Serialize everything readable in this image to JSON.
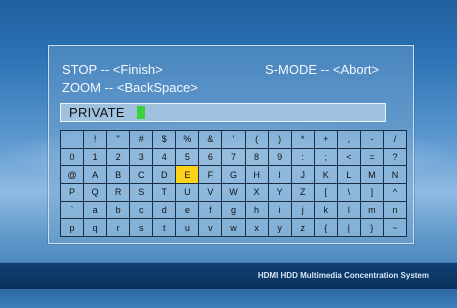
{
  "hints": {
    "stop": "STOP -- <Finish>",
    "smode": "S-MODE -- <Abort>",
    "zoom": "ZOOM -- <BackSpace>"
  },
  "input": {
    "value": "PRIVATE"
  },
  "keyboard": {
    "selected": "E",
    "rows": [
      [
        "",
        "!",
        "\"",
        "#",
        "$",
        "%",
        "&",
        "'",
        "(",
        ")",
        "*",
        "+",
        ",",
        "-",
        "/"
      ],
      [
        "0",
        "1",
        "2",
        "3",
        "4",
        "5",
        "6",
        "7",
        "8",
        "9",
        ":",
        ";",
        "<",
        "=",
        "?"
      ],
      [
        "@",
        "A",
        "B",
        "C",
        "D",
        "E",
        "F",
        "G",
        "H",
        "I",
        "J",
        "K",
        "L",
        "M",
        "N"
      ],
      [
        "P",
        "Q",
        "R",
        "S",
        "T",
        "U",
        "V",
        "W",
        "X",
        "Y",
        "Z",
        "[",
        "\\",
        "]",
        "^"
      ],
      [
        "`",
        "a",
        "b",
        "c",
        "d",
        "e",
        "f",
        "g",
        "h",
        "i",
        "j",
        "k",
        "l",
        "m",
        "n"
      ],
      [
        "p",
        "q",
        "r",
        "s",
        "t",
        "u",
        "v",
        "w",
        "x",
        "y",
        "z",
        "{",
        "|",
        "}",
        "~"
      ]
    ]
  },
  "footer": {
    "label": "HDMI HDD Multimedia Concentration System"
  }
}
